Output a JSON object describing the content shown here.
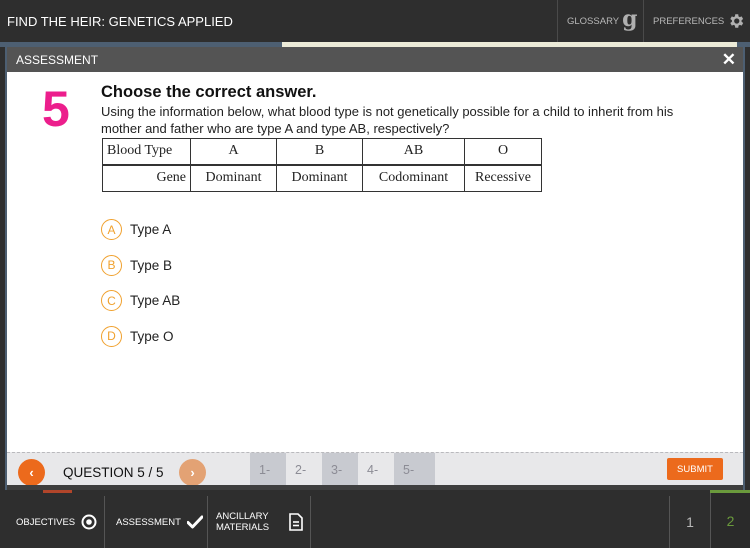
{
  "header": {
    "title": "FIND THE HEIR: GENETICS APPLIED",
    "glossary_label": "GLOSSARY",
    "glossary_icon": "g",
    "preferences_label": "PREFERENCES"
  },
  "modal": {
    "title": "ASSESSMENT",
    "close_icon": "✕",
    "question_number": "5",
    "prompt": "Choose the correct answer.",
    "question_text": "Using the information below, what blood type is not genetically possible for a child to inherit from his mother and father who are type A and type AB, respectively?",
    "table": {
      "header": [
        "Blood Type",
        "A",
        "B",
        "AB",
        "O"
      ],
      "row": [
        "Gene",
        "Dominant",
        "Dominant",
        "Codominant",
        "Recessive"
      ]
    },
    "options": [
      {
        "letter": "A",
        "text": "Type A"
      },
      {
        "letter": "B",
        "text": "Type B"
      },
      {
        "letter": "C",
        "text": "Type AB"
      },
      {
        "letter": "D",
        "text": "Type O"
      }
    ],
    "nav": {
      "prev_icon": "‹",
      "next_icon": "›",
      "question_label": "QUESTION 5 / 5",
      "pages": [
        "1-",
        "2-",
        "3-",
        "4-",
        "5-"
      ],
      "submit_label": "SUBMIT"
    }
  },
  "bottom_nav": {
    "objectives_label": "OBJECTIVES",
    "assessment_label": "ASSESSMENT",
    "ancillary_label_line1": "ANCILLARY",
    "ancillary_label_line2": "MATERIALS",
    "page_1": "1",
    "page_2": "2"
  },
  "colors": {
    "accent_orange": "#ec6a1c",
    "question_number_pink": "#ec1e8c",
    "option_badge": "#f0a12e",
    "active_page_green": "#6a9a3c"
  }
}
